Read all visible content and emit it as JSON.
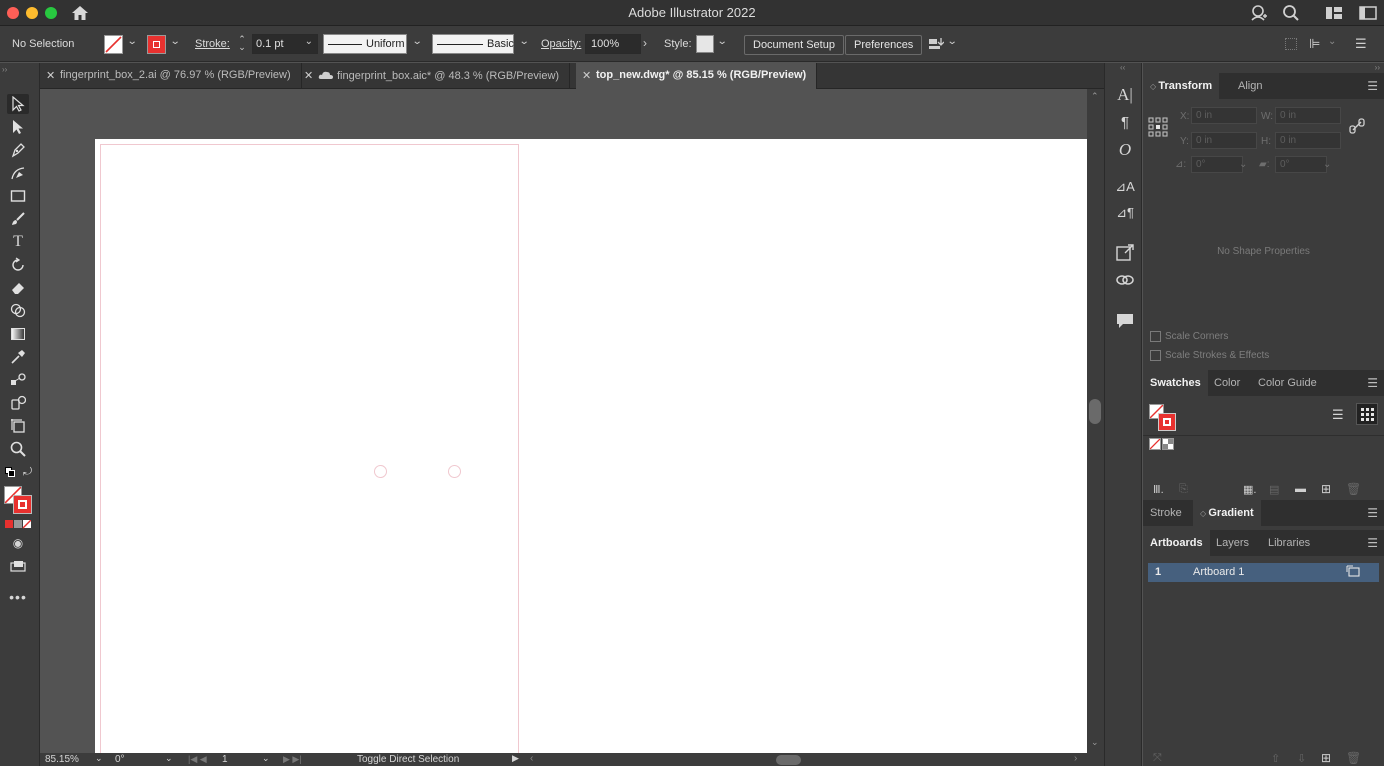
{
  "window": {
    "title": "Adobe Illustrator 2022",
    "traffic_lights": [
      "#ff5f57",
      "#febc2e",
      "#28c840"
    ]
  },
  "control_bar": {
    "selection_status": "No Selection",
    "stroke_label": "Stroke:",
    "stroke_weight": "0.1 pt",
    "stroke_profile": "Uniform",
    "brush_definition": "Basic",
    "opacity_label": "Opacity:",
    "opacity_value": "100%",
    "style_label": "Style:",
    "document_setup_label": "Document Setup",
    "preferences_label": "Preferences"
  },
  "tabs": [
    {
      "label": "fingerprint_box_2.ai @ 76.97 % (RGB/Preview)",
      "active": false,
      "cloud": false
    },
    {
      "label": "fingerprint_box.aic* @ 48.3 % (RGB/Preview)",
      "active": false,
      "cloud": true
    },
    {
      "label": "top_new.dwg* @ 85.15 % (RGB/Preview)",
      "active": true,
      "cloud": false
    }
  ],
  "tools": [
    "selection-tool",
    "direct-selection-tool",
    "pen-tool",
    "curvature-tool",
    "rectangle-tool",
    "paintbrush-tool",
    "type-tool",
    "rotate-tool",
    "eraser-tool",
    "shape-builder-tool",
    "gradient-tool",
    "eyedropper-tool",
    "blend-tool",
    "symbol-sprayer-tool",
    "artboard-tool",
    "zoom-tool"
  ],
  "status_bar": {
    "zoom": "85.15%",
    "rotation": "0°",
    "artboard_number": "1",
    "tool_hint": "Toggle Direct Selection"
  },
  "transform_panel": {
    "tabs": [
      "Transform",
      "Align"
    ],
    "x_label": "X:",
    "x_value": "0 in",
    "y_label": "Y:",
    "y_value": "0 in",
    "w_label": "W:",
    "w_value": "0 in",
    "h_label": "H:",
    "h_value": "0 in",
    "rotate_value": "0°",
    "shear_value": "0°",
    "empty_message": "No Shape Properties",
    "scale_corners_label": "Scale Corners",
    "scale_strokes_label": "Scale Strokes & Effects"
  },
  "swatches_panel": {
    "tabs": [
      "Swatches",
      "Color",
      "Color Guide"
    ]
  },
  "stroke_panel": {
    "tabs": [
      "Stroke",
      "Gradient"
    ]
  },
  "artboards_panel": {
    "tabs": [
      "Artboards",
      "Layers",
      "Libraries"
    ],
    "rows": [
      {
        "number": "1",
        "name": "Artboard 1"
      }
    ]
  },
  "colors": {
    "accent_red": "#e8312f",
    "selection_blue": "#46607e"
  }
}
